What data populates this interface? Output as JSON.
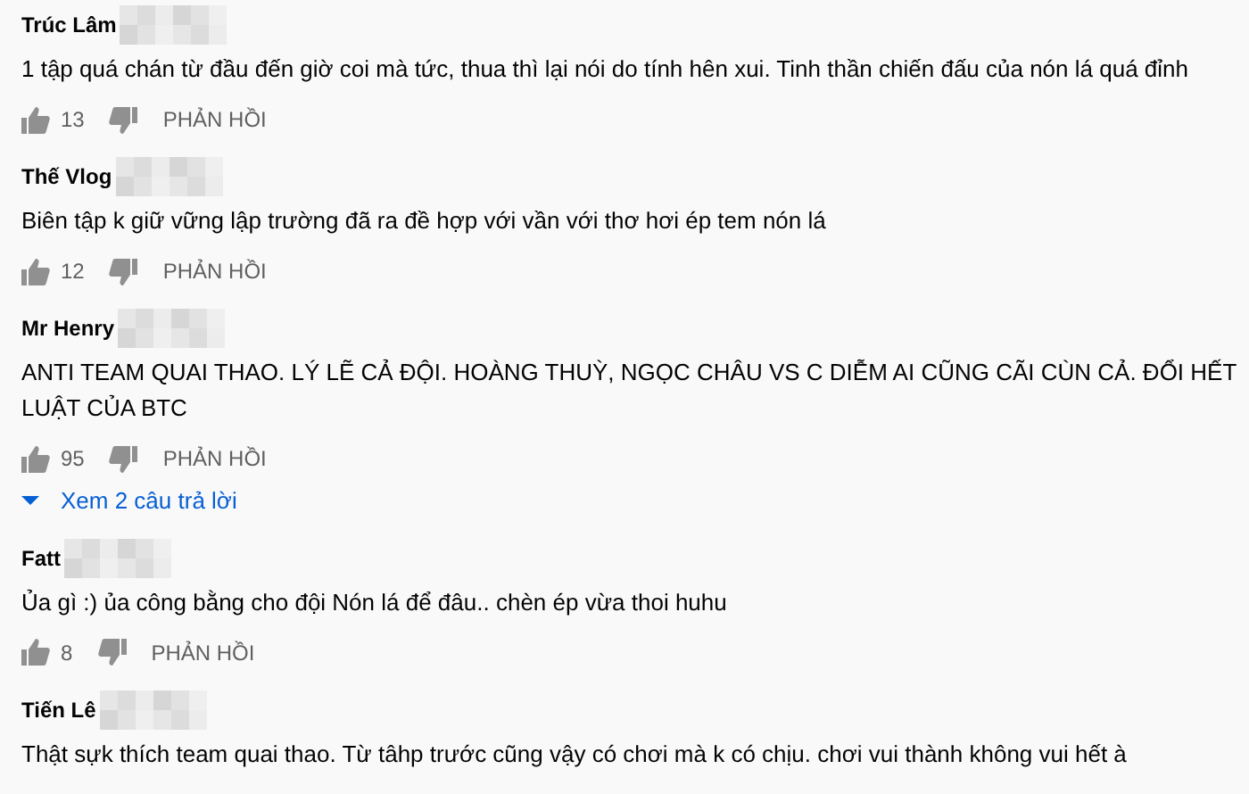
{
  "comments": [
    {
      "author": "Trúc Lâm",
      "text": "1 tập quá chán từ đầu đến giờ coi mà tức, thua thì lại nói do tính hên xui. Tinh thần chiến đấu của nón lá quá đỉnh",
      "likes": "13",
      "reply_label": "PHẢN HỒI"
    },
    {
      "author": "Thế Vlog",
      "text": "Biên tập k giữ vững lập trường đã ra đề hợp với vần với thơ hơi ép tem nón lá",
      "likes": "12",
      "reply_label": "PHẢN HỒI"
    },
    {
      "author": "Mr Henry",
      "text": "ANTI TEAM QUAI THAO. LÝ LẼ CẢ ĐỘI. HOÀNG THUỲ, NGỌC CHÂU VS C DIỄM AI CŨNG CÃI CÙN CẢ. ĐỔI HẾT LUẬT CỦA BTC",
      "likes": "95",
      "reply_label": "PHẢN HỒI",
      "view_replies": "Xem 2 câu trả lời"
    },
    {
      "author": "Fatt",
      "text": "Ủa gì :) ủa công bằng cho đội Nón lá để đâu.. chèn ép vừa thoi huhu",
      "likes": "8",
      "reply_label": "PHẢN HỒI"
    },
    {
      "author": "Tiến Lê",
      "text": "Thật sựk thích team quai thao. Từ tâhp trước cũng vậy có chơi mà k có chịu. chơi vui thành không vui hết à"
    }
  ]
}
